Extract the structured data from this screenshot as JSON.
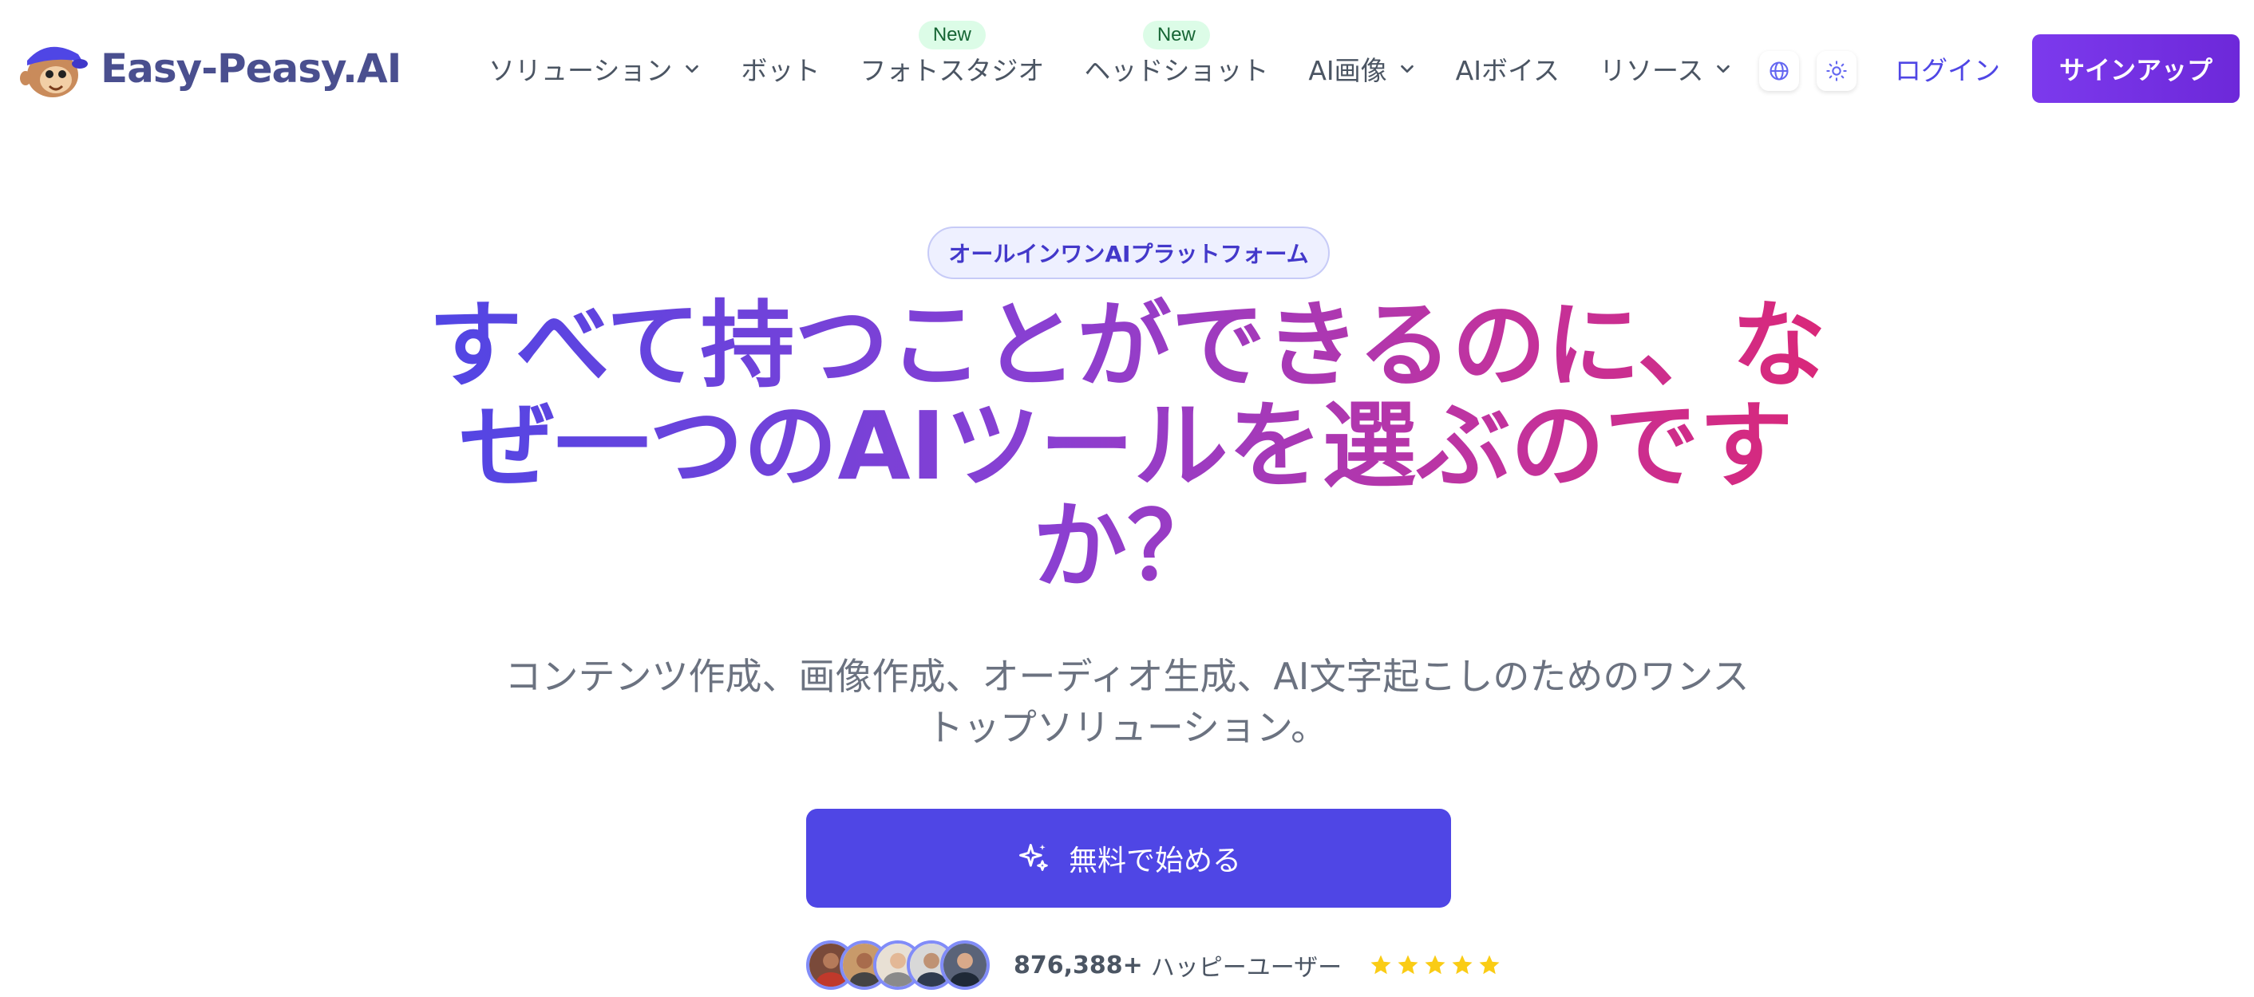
{
  "brand": {
    "name": "Easy-Peasy.AI"
  },
  "nav": {
    "items": [
      {
        "label": "ソリューション",
        "has_dropdown": true
      },
      {
        "label": "ボット",
        "has_dropdown": false
      },
      {
        "label": "フォトスタジオ",
        "has_dropdown": false,
        "badge": "New"
      },
      {
        "label": "ヘッドショット",
        "has_dropdown": false,
        "badge": "New"
      },
      {
        "label": "AI画像",
        "has_dropdown": true
      },
      {
        "label": "AIボイス",
        "has_dropdown": false
      },
      {
        "label": "リソース",
        "has_dropdown": true
      }
    ],
    "language_icon": "globe-icon",
    "theme_icon": "sun-icon",
    "login_label": "ログイン",
    "signup_label": "サインアップ"
  },
  "hero": {
    "pill": "オールインワンAIプラットフォーム",
    "headline": "すべて持つことができるのに、なぜ一つのAIツールを選ぶのですか？",
    "subheadline": "コンテンツ作成、画像作成、オーディオ生成、AI文字起こしのためのワンストップソリューション。",
    "cta_label": "無料で始める",
    "cta_icon": "sparkles-icon"
  },
  "social_proof": {
    "count": "876,388+",
    "label": "ハッピーユーザー",
    "rating": 5
  },
  "colors": {
    "primary": "#4f46e5",
    "signup": "#7c3aed",
    "gradient_start": "#4f46e5",
    "gradient_end": "#db2777",
    "badge_bg": "#dcfce7",
    "badge_text": "#166534",
    "star": "#facc15",
    "muted_text": "#6b7280"
  }
}
